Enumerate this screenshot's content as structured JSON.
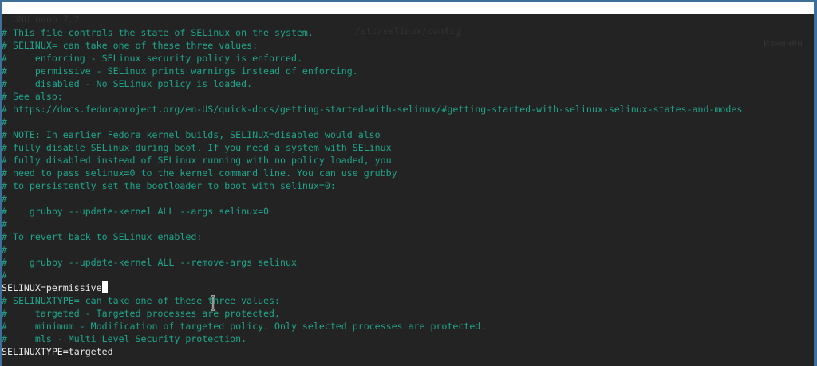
{
  "titlebar": {
    "app": "GNU nano 7.2",
    "file": "/etc/selinux/config",
    "status": "Изменён"
  },
  "lines": [
    {
      "text": "# This file controls the state of SELinux on the system.",
      "type": "comment"
    },
    {
      "text": "# SELINUX= can take one of these three values:",
      "type": "comment"
    },
    {
      "text": "#     enforcing - SELinux security policy is enforced.",
      "type": "comment"
    },
    {
      "text": "#     permissive - SELinux prints warnings instead of enforcing.",
      "type": "comment"
    },
    {
      "text": "#     disabled - No SELinux policy is loaded.",
      "type": "comment"
    },
    {
      "text": "# See also:",
      "type": "comment"
    },
    {
      "text": "# https://docs.fedoraproject.org/en-US/quick-docs/getting-started-with-selinux/#getting-started-with-selinux-selinux-states-and-modes",
      "type": "comment"
    },
    {
      "text": "#",
      "type": "comment"
    },
    {
      "text": "# NOTE: In earlier Fedora kernel builds, SELINUX=disabled would also",
      "type": "comment"
    },
    {
      "text": "# fully disable SELinux during boot. If you need a system with SELinux",
      "type": "comment"
    },
    {
      "text": "# fully disabled instead of SELinux running with no policy loaded, you",
      "type": "comment"
    },
    {
      "text": "# need to pass selinux=0 to the kernel command line. You can use grubby",
      "type": "comment"
    },
    {
      "text": "# to persistently set the bootloader to boot with selinux=0:",
      "type": "comment"
    },
    {
      "text": "#",
      "type": "comment"
    },
    {
      "text": "#    grubby --update-kernel ALL --args selinux=0",
      "type": "comment"
    },
    {
      "text": "#",
      "type": "comment"
    },
    {
      "text": "# To revert back to SELinux enabled:",
      "type": "comment"
    },
    {
      "text": "#",
      "type": "comment"
    },
    {
      "text": "#    grubby --update-kernel ALL --remove-args selinux",
      "type": "comment"
    },
    {
      "text": "#",
      "type": "comment"
    },
    {
      "text": "SELINUX=permissive",
      "type": "code",
      "cursor": true
    },
    {
      "text": "# SELINUXTYPE= can take one of these three values:",
      "type": "comment"
    },
    {
      "text": "#     targeted - Targeted processes are protected,",
      "type": "comment"
    },
    {
      "text": "#     minimum - Modification of targeted policy. Only selected processes are protected.",
      "type": "comment"
    },
    {
      "text": "#     mls - Multi Level Security protection.",
      "type": "comment"
    },
    {
      "text": "SELINUXTYPE=targeted",
      "type": "code"
    }
  ]
}
